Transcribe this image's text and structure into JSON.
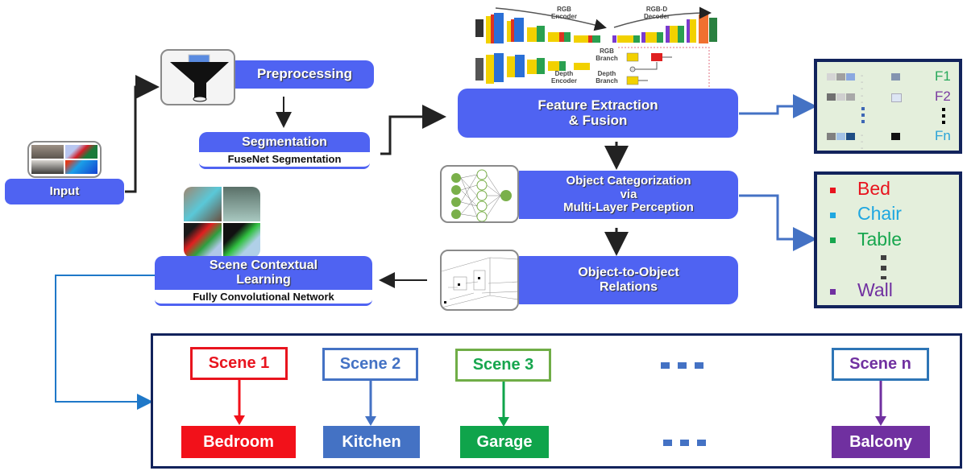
{
  "input": {
    "label": "Input"
  },
  "preprocessing": {
    "label": "Preprocessing",
    "icon": "funnel-icon"
  },
  "segmentation": {
    "label": "Segmentation",
    "sub_label": "FuseNet Segmentation"
  },
  "feature_extraction": {
    "label_line1": "Feature Extraction",
    "label_line2": "& Fusion",
    "network": {
      "rgb_encoder": [
        "RGB",
        "Encoder"
      ],
      "rgbd_decoder": [
        "RGB-D",
        "Decoder"
      ],
      "depth_encoder": [
        "Depth",
        "Encoder"
      ],
      "rgb_branch": [
        "RGB",
        "Branch"
      ],
      "depth_branch": [
        "Depth",
        "Branch"
      ]
    }
  },
  "features_panel": {
    "rows": [
      {
        "label": "F1",
        "color": "#27a85a"
      },
      {
        "label": "F2",
        "color": "#7a3aa0"
      },
      {
        "label": "Fn",
        "color": "#2aa3d8"
      }
    ]
  },
  "object_categorization": {
    "line1": "Object Categorization",
    "line2": "via",
    "line3": "Multi-Layer Perception"
  },
  "objects_panel": {
    "items": [
      {
        "label": "Bed",
        "color": "#e8141e"
      },
      {
        "label": "Chair",
        "color": "#1fa7e0"
      },
      {
        "label": "Table",
        "color": "#17a64e"
      },
      {
        "label": "Wall",
        "color": "#7030a0"
      }
    ]
  },
  "object_relations": {
    "line1": "Object-to-Object",
    "line2": "Relations"
  },
  "scene_learning": {
    "line1": "Scene Contextual",
    "line2": "Learning",
    "sub_label": "Fully Convolutional Network"
  },
  "scenes": [
    {
      "scene": "Scene 1",
      "class": "Bedroom",
      "border": "#e8141e",
      "text": "#e8141e",
      "fill": "#f2111a"
    },
    {
      "scene": "Scene 2",
      "class": "Kitchen",
      "border": "#4472c4",
      "text": "#4472c4",
      "fill": "#4472c4"
    },
    {
      "scene": "Scene 3",
      "class": "Garage",
      "border": "#70ad47",
      "text": "#17a64e",
      "fill": "#0fa44b"
    },
    {
      "scene": "Scene n",
      "class": "Balcony",
      "border": "#2e75b6",
      "text": "#7030a0",
      "fill": "#7030a0"
    }
  ],
  "colors": {
    "box_blue": "#4f63f2",
    "panel_border": "#12235c",
    "panel_bg": "#e4efdc",
    "connector_blue": "#4472c4"
  }
}
